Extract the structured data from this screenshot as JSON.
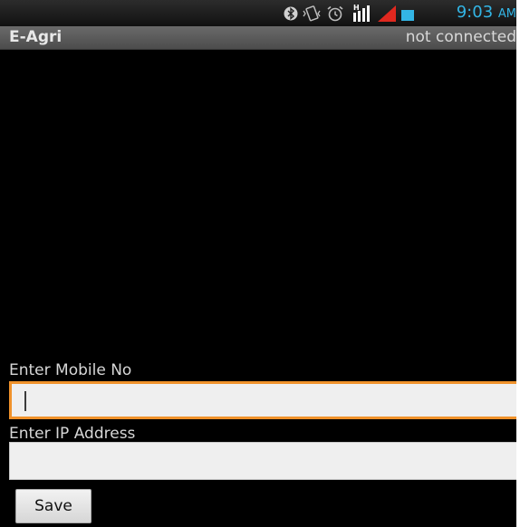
{
  "status_bar": {
    "time": "9:03",
    "ampm": "AM",
    "icons": [
      "bluetooth-icon",
      "vibrate-icon",
      "alarm-icon",
      "data-signal-icon",
      "cell-signal-icon",
      "battery-icon"
    ],
    "colors": {
      "time": "#33b5e5",
      "signal": "#e0281f"
    }
  },
  "title_bar": {
    "title": "E-Agri",
    "status": "not connected"
  },
  "form": {
    "mobile_label": "Enter Mobile No",
    "mobile_value": "",
    "ip_label": "Enter IP Address",
    "ip_value": "",
    "save_label": "Save",
    "colors": {
      "focus_border": "#f0922b"
    }
  }
}
